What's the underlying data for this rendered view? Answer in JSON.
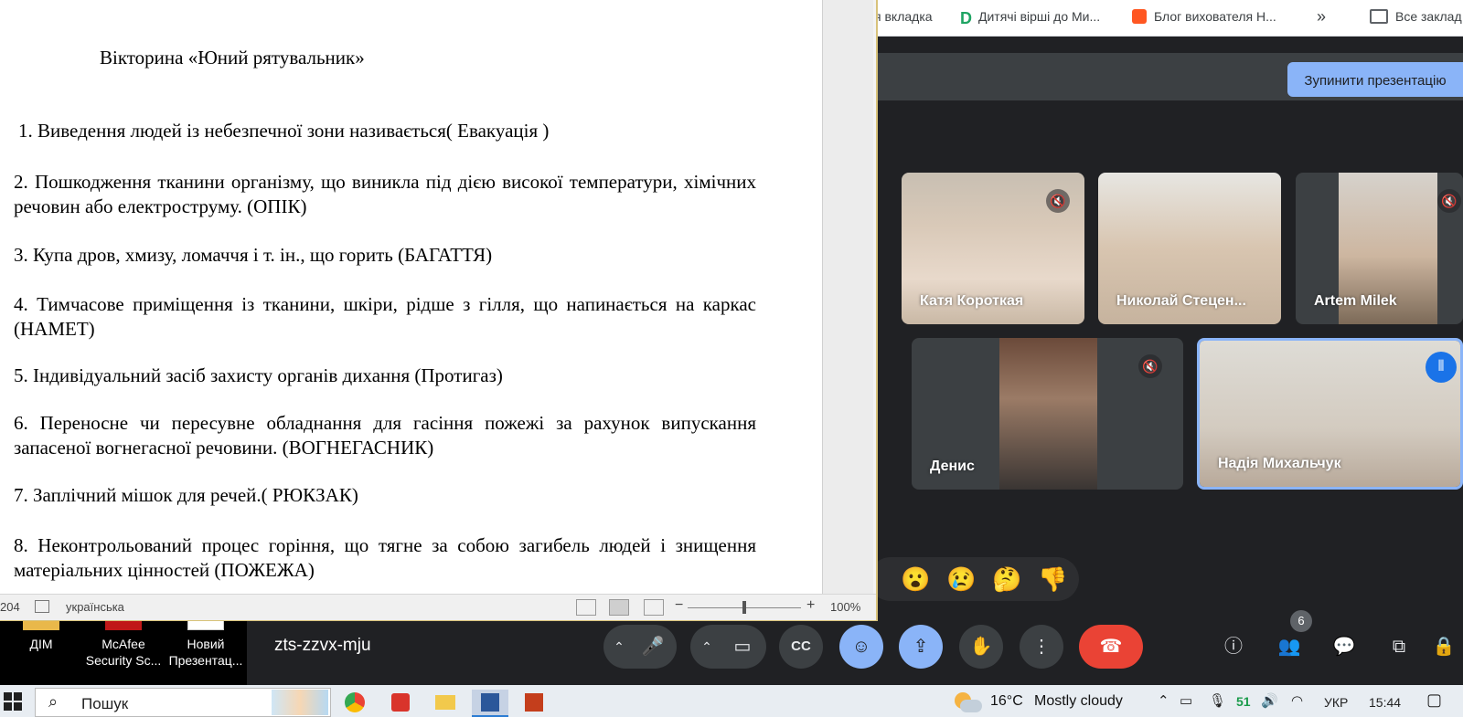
{
  "bookmarks": {
    "partial_tab": "я вкладка",
    "verses": "Дитячі вірші до Ми...",
    "blog": "Блог вихователя Н...",
    "more": "»",
    "all": "Все заклад"
  },
  "meet": {
    "stop_presenting": "Зупинити презентацію",
    "meeting_code": "zts-zzvx-mju",
    "participants_badge": "6",
    "participants": [
      {
        "name": "Катя Короткая",
        "muted": true
      },
      {
        "name": "Николай Стецен...",
        "muted": false
      },
      {
        "name": "Artem Milek",
        "muted": true
      },
      {
        "name": "Денис",
        "muted": true
      },
      {
        "name": "Надія Михальчук",
        "speaking": true
      }
    ],
    "reactions": [
      "😮",
      "😢",
      "🤔",
      "👎"
    ],
    "controls": {
      "chevron": "⌃",
      "mic": "🎤",
      "camera": "▭",
      "captions": "CC",
      "emoji": "☺",
      "present": "⇪",
      "raise_hand": "✋",
      "more": "⋮",
      "hangup": "☎",
      "info": "ⓘ",
      "people": "👥",
      "chat": "💬",
      "activities": "⧉",
      "lock": "🔒"
    }
  },
  "desktop": {
    "icons": [
      {
        "label": "ДІМ"
      },
      {
        "label": "McAfee Security Sc..."
      },
      {
        "label": "Новий Презентац..."
      }
    ]
  },
  "document": {
    "title": "Вікторина «Юний рятувальник»",
    "questions": [
      "1.  Виведення людей із небезпечної зони називається( Евакуація )",
      " 2. Пошкодження тканини організму, що виникла під дією високої температури, хімічних речовин або електроструму. (ОПІК)",
      "3. Купа дров, хмизу, ломаччя і т. ін., що горить (БАГАТТЯ)",
      "4. Тимчасове приміщення із тканини, шкіри, рідше з гілля, що напинається на каркас (НАМЕТ)",
      "5. Індивідуальний засіб захисту органів дихання (Протигаз)",
      "6. Переносне чи пересувне обладнання для гасіння пожежі за рахунок випускання запасеної вогнегасної речовини. (ВОГНЕГАСНИК)",
      "7. Заплічний мішок для речей.( РЮКЗАК)",
      "8. Неконтрольований процес горіння, що тягне за собою загибель людей і знищення матеріальних цінностей (ПОЖЕЖА)"
    ]
  },
  "statusbar": {
    "words": "204",
    "language": "українська",
    "zoom_minus": "−",
    "zoom_plus": "+",
    "zoom": "100%",
    "zoom_fraction": 0.5
  },
  "taskbar": {
    "search_placeholder": "Пошук",
    "search_icon": "⌕",
    "weather_temp": "16°C",
    "weather_desc": "Mostly cloudy",
    "tray_up": "⌃",
    "tray_battery": "▭",
    "tray_mic": "🎙",
    "tray_number": "51",
    "tray_volume": "🔊",
    "tray_wifi": "◠",
    "lang": "УКР",
    "time": "15:44",
    "notifications": "▢"
  }
}
